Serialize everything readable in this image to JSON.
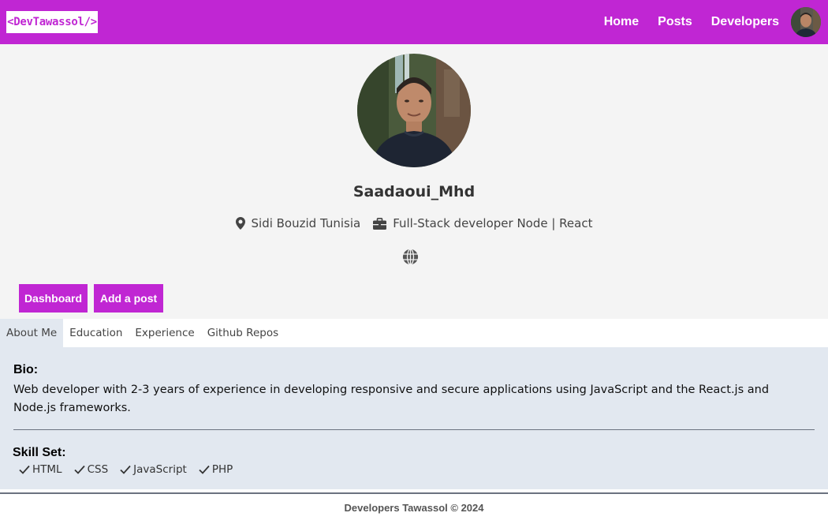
{
  "navbar": {
    "brand": "<DevTawassol/>",
    "links": [
      "Home",
      "Posts",
      "Developers"
    ],
    "accent_color": "#c026d3",
    "avatar_icon": "user-avatar"
  },
  "profile": {
    "username": "Saadaoui_Mhd",
    "location": "Sidi Bouzid Tunisia",
    "status": "Full-Stack developer Node | React",
    "location_icon": "map-marker-icon",
    "status_icon": "briefcase-icon",
    "website_icon": "globe-icon"
  },
  "actions": {
    "dashboard": "Dashboard",
    "add_post": "Add a post"
  },
  "tabs": {
    "items": [
      "About Me",
      "Education",
      "Experience",
      "Github Repos"
    ],
    "active": "About Me"
  },
  "about": {
    "bio_title": "Bio:",
    "bio_text": "Web developer with 2-3 years of experience in developing responsive and secure applications using JavaScript and the React.js and Node.js frameworks.",
    "skills_title": "Skill Set:",
    "skills": [
      "HTML",
      "CSS",
      "JavaScript",
      "PHP"
    ],
    "skill_icon": "check-icon"
  },
  "footer": {
    "text": "Developers Tawassol © 2024"
  }
}
